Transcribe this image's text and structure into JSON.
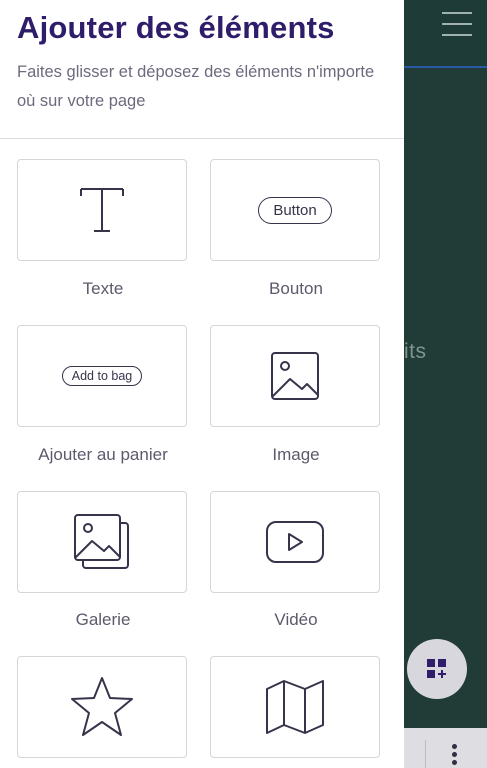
{
  "panel": {
    "title": "Ajouter des éléments",
    "subtitle": "Faites glisser et déposez des éléments n'importe où sur votre page"
  },
  "elements": [
    {
      "label": "Texte",
      "icon": "text-t-icon"
    },
    {
      "label": "Bouton",
      "icon": "button-icon",
      "preview": "Button"
    },
    {
      "label": "Ajouter au panier",
      "icon": "add-to-bag-icon",
      "preview": "Add to bag"
    },
    {
      "label": "Image",
      "icon": "image-icon"
    },
    {
      "label": "Galerie",
      "icon": "gallery-icon"
    },
    {
      "label": "Vidéo",
      "icon": "video-play-icon"
    },
    {
      "label": "",
      "icon": "star-icon"
    },
    {
      "label": "",
      "icon": "map-icon"
    }
  ],
  "background_page": {
    "partial_text": "its",
    "colors": {
      "page": "#213b37",
      "accent": "#2f1c6a"
    }
  }
}
